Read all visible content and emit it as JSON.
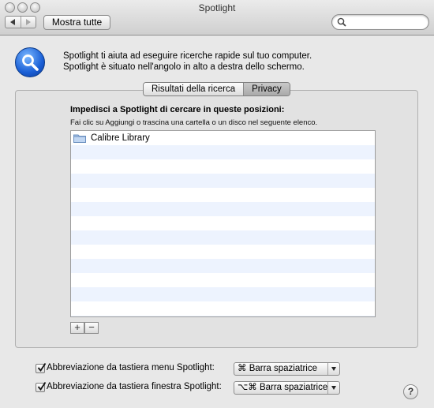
{
  "window": {
    "title": "Spotlight"
  },
  "toolbar": {
    "show_all_label": "Mostra tutte",
    "search_value": ""
  },
  "header": {
    "description_line1": "Spotlight ti aiuta ad eseguire ricerche rapide sul tuo computer.",
    "description_line2": "Spotlight è situato nell'angolo in alto a destra dello schermo."
  },
  "tabs": [
    {
      "label": "Risultati della ricerca",
      "selected": false
    },
    {
      "label": "Privacy",
      "selected": true
    }
  ],
  "privacy": {
    "heading": "Impedisci a Spotlight di cercare in queste posizioni:",
    "hint": "Fai clic su Aggiungi o trascina una cartella o un disco nel seguente elenco.",
    "items": [
      {
        "label": "Calibre Library",
        "icon": "folder-icon"
      }
    ],
    "add_label": "+",
    "remove_label": "−"
  },
  "shortcuts": [
    {
      "label": "Abbreviazione da tastiera menu Spotlight:",
      "checked": true,
      "value": "⌘ Barra spaziatrice"
    },
    {
      "label": "Abbreviazione da tastiera finestra Spotlight:",
      "checked": true,
      "value": "⌥⌘ Barra spaziatrice"
    }
  ],
  "help_label": "?",
  "colors": {
    "accent": "#1a5fd6",
    "list_stripe": "#edf3fe"
  }
}
